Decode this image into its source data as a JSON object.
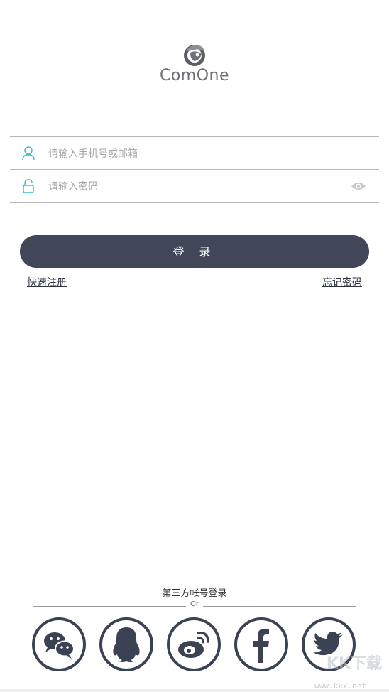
{
  "brand": {
    "name": "ComOne"
  },
  "login_form": {
    "account_placeholder": "请输入手机号或邮箱",
    "password_placeholder": "请输入密码",
    "login_label": "登 录",
    "register_link": "快速注册",
    "forgot_link": "忘记密码"
  },
  "third_party": {
    "title": "第三方帐号登录",
    "divider_text": "Or",
    "providers": [
      {
        "name": "WeChat",
        "icon": "wechat-icon"
      },
      {
        "name": "QQ",
        "icon": "qq-icon"
      },
      {
        "name": "Weibo",
        "icon": "weibo-icon"
      },
      {
        "name": "Facebook",
        "icon": "facebook-icon"
      },
      {
        "name": "Twitter",
        "icon": "twitter-icon"
      }
    ]
  },
  "watermark": {
    "brand": "KK下载",
    "url": "www.kkx.net"
  },
  "colors": {
    "primary": "#424659",
    "accent": "#3bbfcf",
    "icon_outline": "#3b4253",
    "border": "#b8b8b8"
  }
}
